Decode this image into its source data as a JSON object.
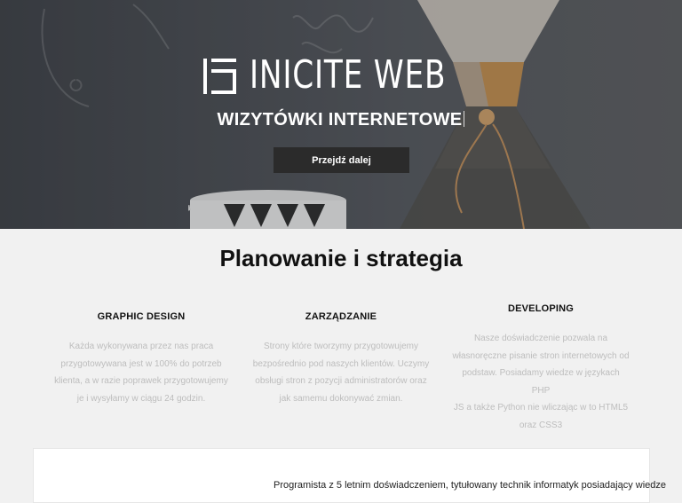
{
  "hero": {
    "logo_text": "INICITE WEB",
    "subtitle": "WIZYTÓWKI INTERNETOWE",
    "cta_label": "Przejdź dalej"
  },
  "section": {
    "title": "Planowanie i strategia",
    "features": [
      {
        "title": "GRAPHIC DESIGN",
        "lines": [
          "Każda wykonywana przez nas praca",
          "przygotowywana jest w 100% do potrzeb",
          "klienta, a w razie poprawek przygotowujemy",
          "je i wysyłamy w ciągu 24 godzin."
        ]
      },
      {
        "title": "ZARZĄDZANIE",
        "lines": [
          "Strony które tworzymy przygotowujemy",
          "bezpośrednio pod naszych klientów. Uczymy",
          "obsługi stron z pozycji administratorów oraz",
          "jak samemu dokonywać zmian."
        ]
      },
      {
        "title": "DEVELOPING",
        "lines": [
          "Nasze doświadczenie pozwala na",
          "własnoręczne pisanie stron internetowych od",
          "podstaw. Posiadamy wiedze w językach PHP",
          "JS a także Python nie wliczając w to HTML5",
          "oraz CSS3"
        ]
      }
    ]
  },
  "about": {
    "text": "Programista z 5 letnim doświadczeniem, tytułowany technik informatyk posiadający wiedze"
  }
}
